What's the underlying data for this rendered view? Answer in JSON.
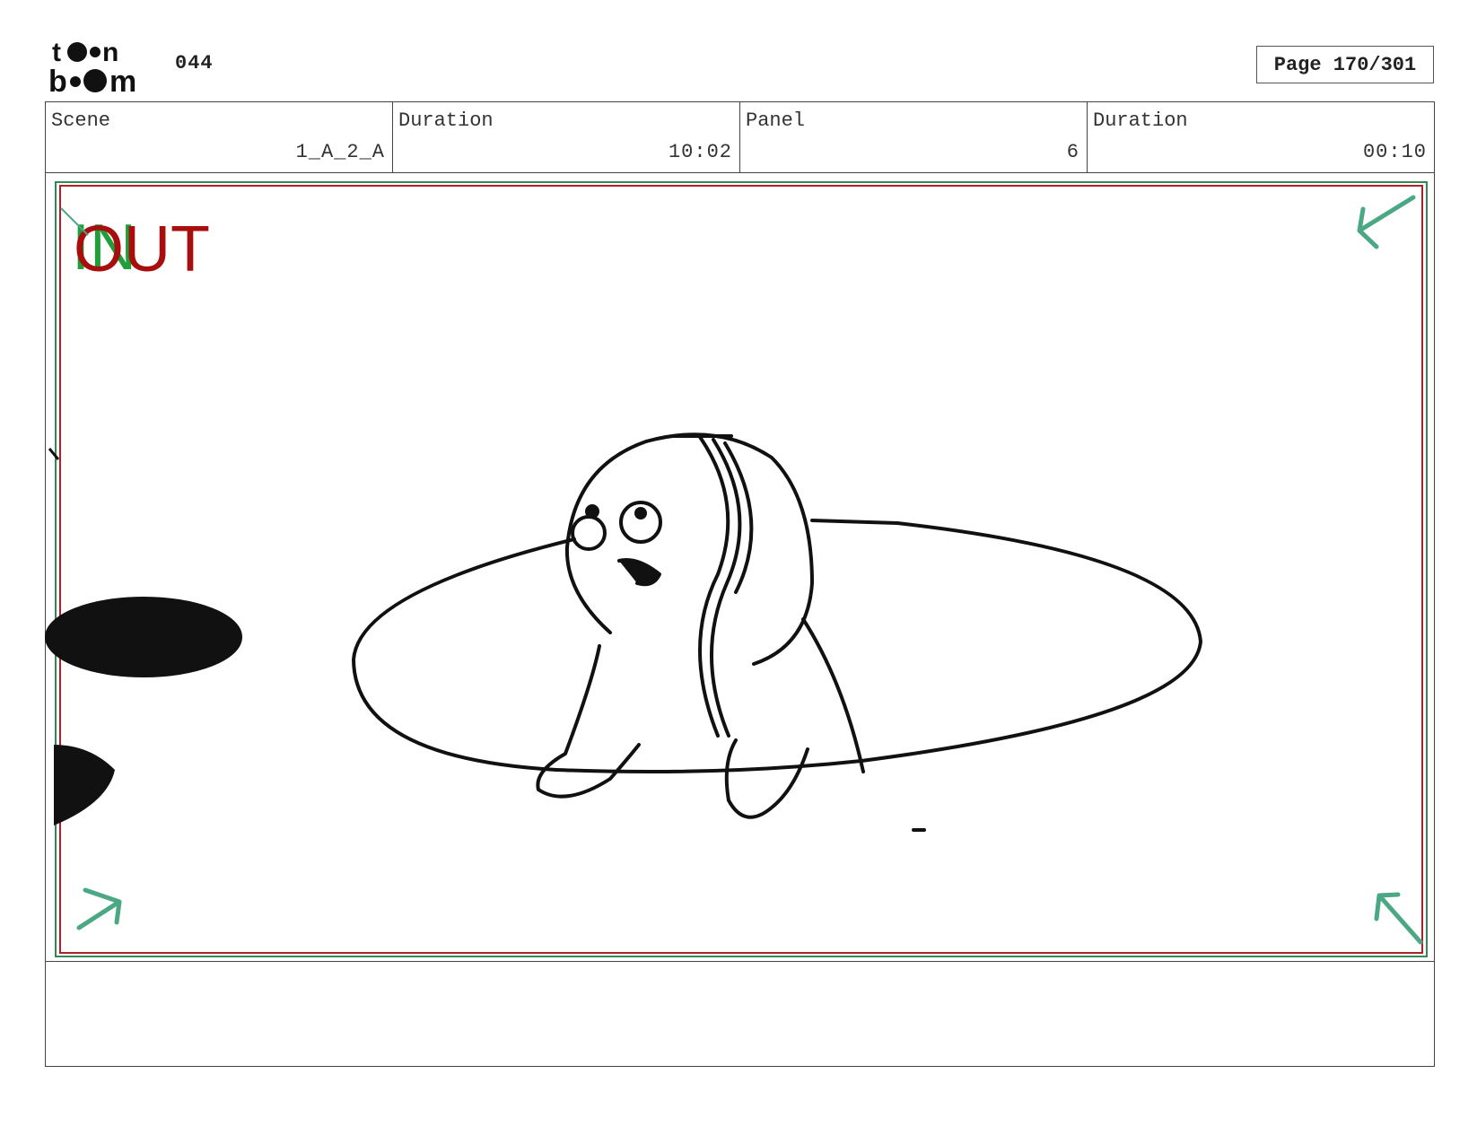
{
  "header": {
    "logo": {
      "icon": "toonboom-logo-icon",
      "line1": "toon",
      "line2": "boom"
    },
    "project_code": "044",
    "page_label": "Page 170/301"
  },
  "info_table": [
    {
      "label": "Scene",
      "value": "1_A_2_A"
    },
    {
      "label": "Duration",
      "value": "10:02"
    },
    {
      "label": "Panel",
      "value": "6"
    },
    {
      "label": "Duration",
      "value": "00:10"
    }
  ],
  "panel": {
    "in_label": "IN",
    "out_label": "OUT",
    "colors": {
      "in": "#1f9e3a",
      "out": "#a80e0e",
      "safe_frame_green": "#2e8b57",
      "safe_frame_red": "#b0202a",
      "corner_arrows": "#4aa884"
    },
    "icons": [
      "corner-arrow-top-left-icon",
      "corner-arrow-top-right-icon",
      "corner-arrow-bottom-left-icon",
      "corner-arrow-bottom-right-icon"
    ]
  },
  "notes": {
    "text": ""
  }
}
